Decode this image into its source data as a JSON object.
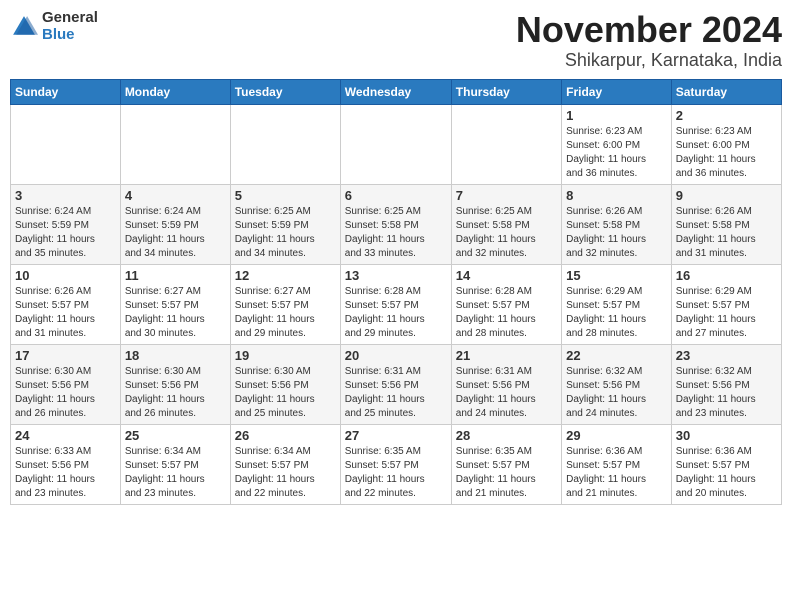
{
  "header": {
    "logo_general": "General",
    "logo_blue": "Blue",
    "month": "November 2024",
    "location": "Shikarpur, Karnataka, India"
  },
  "weekdays": [
    "Sunday",
    "Monday",
    "Tuesday",
    "Wednesday",
    "Thursday",
    "Friday",
    "Saturday"
  ],
  "weeks": [
    [
      {
        "day": "",
        "info": ""
      },
      {
        "day": "",
        "info": ""
      },
      {
        "day": "",
        "info": ""
      },
      {
        "day": "",
        "info": ""
      },
      {
        "day": "",
        "info": ""
      },
      {
        "day": "1",
        "info": "Sunrise: 6:23 AM\nSunset: 6:00 PM\nDaylight: 11 hours\nand 36 minutes."
      },
      {
        "day": "2",
        "info": "Sunrise: 6:23 AM\nSunset: 6:00 PM\nDaylight: 11 hours\nand 36 minutes."
      }
    ],
    [
      {
        "day": "3",
        "info": "Sunrise: 6:24 AM\nSunset: 5:59 PM\nDaylight: 11 hours\nand 35 minutes."
      },
      {
        "day": "4",
        "info": "Sunrise: 6:24 AM\nSunset: 5:59 PM\nDaylight: 11 hours\nand 34 minutes."
      },
      {
        "day": "5",
        "info": "Sunrise: 6:25 AM\nSunset: 5:59 PM\nDaylight: 11 hours\nand 34 minutes."
      },
      {
        "day": "6",
        "info": "Sunrise: 6:25 AM\nSunset: 5:58 PM\nDaylight: 11 hours\nand 33 minutes."
      },
      {
        "day": "7",
        "info": "Sunrise: 6:25 AM\nSunset: 5:58 PM\nDaylight: 11 hours\nand 32 minutes."
      },
      {
        "day": "8",
        "info": "Sunrise: 6:26 AM\nSunset: 5:58 PM\nDaylight: 11 hours\nand 32 minutes."
      },
      {
        "day": "9",
        "info": "Sunrise: 6:26 AM\nSunset: 5:58 PM\nDaylight: 11 hours\nand 31 minutes."
      }
    ],
    [
      {
        "day": "10",
        "info": "Sunrise: 6:26 AM\nSunset: 5:57 PM\nDaylight: 11 hours\nand 31 minutes."
      },
      {
        "day": "11",
        "info": "Sunrise: 6:27 AM\nSunset: 5:57 PM\nDaylight: 11 hours\nand 30 minutes."
      },
      {
        "day": "12",
        "info": "Sunrise: 6:27 AM\nSunset: 5:57 PM\nDaylight: 11 hours\nand 29 minutes."
      },
      {
        "day": "13",
        "info": "Sunrise: 6:28 AM\nSunset: 5:57 PM\nDaylight: 11 hours\nand 29 minutes."
      },
      {
        "day": "14",
        "info": "Sunrise: 6:28 AM\nSunset: 5:57 PM\nDaylight: 11 hours\nand 28 minutes."
      },
      {
        "day": "15",
        "info": "Sunrise: 6:29 AM\nSunset: 5:57 PM\nDaylight: 11 hours\nand 28 minutes."
      },
      {
        "day": "16",
        "info": "Sunrise: 6:29 AM\nSunset: 5:57 PM\nDaylight: 11 hours\nand 27 minutes."
      }
    ],
    [
      {
        "day": "17",
        "info": "Sunrise: 6:30 AM\nSunset: 5:56 PM\nDaylight: 11 hours\nand 26 minutes."
      },
      {
        "day": "18",
        "info": "Sunrise: 6:30 AM\nSunset: 5:56 PM\nDaylight: 11 hours\nand 26 minutes."
      },
      {
        "day": "19",
        "info": "Sunrise: 6:30 AM\nSunset: 5:56 PM\nDaylight: 11 hours\nand 25 minutes."
      },
      {
        "day": "20",
        "info": "Sunrise: 6:31 AM\nSunset: 5:56 PM\nDaylight: 11 hours\nand 25 minutes."
      },
      {
        "day": "21",
        "info": "Sunrise: 6:31 AM\nSunset: 5:56 PM\nDaylight: 11 hours\nand 24 minutes."
      },
      {
        "day": "22",
        "info": "Sunrise: 6:32 AM\nSunset: 5:56 PM\nDaylight: 11 hours\nand 24 minutes."
      },
      {
        "day": "23",
        "info": "Sunrise: 6:32 AM\nSunset: 5:56 PM\nDaylight: 11 hours\nand 23 minutes."
      }
    ],
    [
      {
        "day": "24",
        "info": "Sunrise: 6:33 AM\nSunset: 5:56 PM\nDaylight: 11 hours\nand 23 minutes."
      },
      {
        "day": "25",
        "info": "Sunrise: 6:34 AM\nSunset: 5:57 PM\nDaylight: 11 hours\nand 23 minutes."
      },
      {
        "day": "26",
        "info": "Sunrise: 6:34 AM\nSunset: 5:57 PM\nDaylight: 11 hours\nand 22 minutes."
      },
      {
        "day": "27",
        "info": "Sunrise: 6:35 AM\nSunset: 5:57 PM\nDaylight: 11 hours\nand 22 minutes."
      },
      {
        "day": "28",
        "info": "Sunrise: 6:35 AM\nSunset: 5:57 PM\nDaylight: 11 hours\nand 21 minutes."
      },
      {
        "day": "29",
        "info": "Sunrise: 6:36 AM\nSunset: 5:57 PM\nDaylight: 11 hours\nand 21 minutes."
      },
      {
        "day": "30",
        "info": "Sunrise: 6:36 AM\nSunset: 5:57 PM\nDaylight: 11 hours\nand 20 minutes."
      }
    ]
  ]
}
